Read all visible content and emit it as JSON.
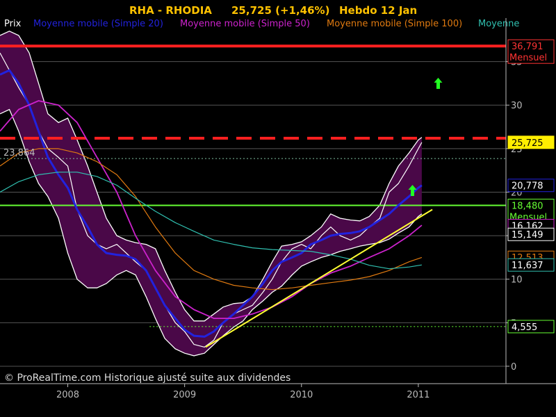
{
  "header": {
    "title": "RHA - RHODIA",
    "price_change": "25,725 (+1,46%)",
    "period": "Hebdo  12 Jan"
  },
  "legend": [
    {
      "label": "Prix",
      "color": "#ffffff"
    },
    {
      "label": "Moyenne mobile (Simple 20)",
      "color": "#2222dd"
    },
    {
      "label": "Moyenne mobile (Simple 50)",
      "color": "#cc22cc"
    },
    {
      "label": "Moyenne mobile (Simple 100)",
      "color": "#e07a10"
    },
    {
      "label": "Moyenne",
      "color": "#30c0b0"
    }
  ],
  "copyright": "© ProRealTime.com Historique ajusté suite aux dividendes",
  "chart_data": {
    "type": "line",
    "ylim": [
      -2,
      40
    ],
    "xlim": [
      2007.42,
      2011.75
    ],
    "y_ticks": [
      "0",
      "5",
      "10",
      "15",
      "20",
      "25",
      "30",
      "35"
    ],
    "y_tick_values": [
      0,
      5,
      10,
      15,
      20,
      25,
      30,
      35
    ],
    "x_ticks": [
      "2008",
      "2009",
      "2010",
      "2011"
    ],
    "x_tick_values": [
      2008,
      2009,
      2010,
      2011
    ],
    "series": [
      {
        "key": "price",
        "color": "#ffffff",
        "x": [
          2007.42,
          2007.5,
          2007.58,
          2007.67,
          2007.75,
          2007.83,
          2007.92,
          2008.0,
          2008.08,
          2008.17,
          2008.25,
          2008.33,
          2008.42,
          2008.5,
          2008.58,
          2008.67,
          2008.75,
          2008.83,
          2008.92,
          2009.0,
          2009.08,
          2009.17,
          2009.25,
          2009.33,
          2009.42,
          2009.5,
          2009.58,
          2009.67,
          2009.75,
          2009.83,
          2009.92,
          2010.0,
          2010.08,
          2010.17,
          2010.25,
          2010.33,
          2010.42,
          2010.5,
          2010.58,
          2010.67,
          2010.75,
          2010.83,
          2010.92,
          2011.0,
          2011.03
        ],
        "y": [
          36,
          34,
          32,
          30,
          27,
          25,
          24,
          23,
          18,
          15,
          14,
          13.5,
          14,
          13,
          12,
          11,
          9,
          7,
          5,
          4,
          2.5,
          2.2,
          3,
          5,
          6,
          6.5,
          7,
          8.5,
          10,
          12,
          13.5,
          14,
          13.5,
          15,
          16,
          15,
          14.5,
          15,
          16,
          17,
          20,
          21,
          23,
          25,
          25.725
        ]
      },
      {
        "key": "ma20",
        "color": "#2222dd",
        "x": [
          2007.42,
          2007.5,
          2007.58,
          2007.67,
          2007.75,
          2007.83,
          2007.92,
          2008.0,
          2008.08,
          2008.17,
          2008.25,
          2008.33,
          2008.42,
          2008.5,
          2008.58,
          2008.67,
          2008.75,
          2008.83,
          2008.92,
          2009.0,
          2009.08,
          2009.17,
          2009.25,
          2009.33,
          2009.42,
          2009.5,
          2009.58,
          2009.67,
          2009.75,
          2009.83,
          2009.92,
          2010.0,
          2010.08,
          2010.17,
          2010.25,
          2010.33,
          2010.42,
          2010.5,
          2010.58,
          2010.67,
          2010.75,
          2010.83,
          2010.92,
          2011.0,
          2011.03
        ],
        "y": [
          33.5,
          34,
          32.5,
          30,
          27,
          24,
          22,
          20.5,
          18,
          16,
          14,
          13,
          12.8,
          12.7,
          12.3,
          11,
          9,
          7,
          5.5,
          4.2,
          3.5,
          3.4,
          4,
          5,
          6,
          7,
          8,
          9.5,
          11,
          12,
          12.5,
          13,
          14,
          14.5,
          15,
          15.2,
          15.3,
          15.5,
          16,
          16.8,
          17.5,
          18.5,
          19.5,
          20.5,
          20.778
        ]
      },
      {
        "key": "ma50",
        "color": "#cc22cc",
        "x": [
          2007.42,
          2007.58,
          2007.75,
          2007.92,
          2008.08,
          2008.25,
          2008.42,
          2008.58,
          2008.75,
          2008.92,
          2009.08,
          2009.25,
          2009.42,
          2009.58,
          2009.75,
          2009.92,
          2010.08,
          2010.25,
          2010.42,
          2010.58,
          2010.75,
          2010.92,
          2011.03
        ],
        "y": [
          27,
          29.5,
          30.5,
          30,
          28,
          24,
          20,
          15,
          11,
          8,
          6.5,
          5.5,
          5.5,
          6,
          6.8,
          8,
          9.5,
          10.7,
          11.5,
          12.5,
          13.5,
          15,
          16.2
        ]
      },
      {
        "key": "ma100",
        "color": "#e07a10",
        "x": [
          2007.42,
          2007.58,
          2007.75,
          2007.92,
          2008.08,
          2008.25,
          2008.42,
          2008.58,
          2008.75,
          2008.92,
          2009.08,
          2009.25,
          2009.42,
          2009.58,
          2009.75,
          2009.92,
          2010.08,
          2010.25,
          2010.42,
          2010.58,
          2010.75,
          2010.92,
          2011.03
        ],
        "y": [
          23,
          24.5,
          25,
          25,
          24.5,
          23.5,
          22,
          19.5,
          16,
          13,
          11,
          10,
          9.3,
          9,
          8.8,
          9,
          9.3,
          9.6,
          9.9,
          10.3,
          11,
          12,
          12.5
        ]
      },
      {
        "key": "ma200",
        "color": "#30c0b0",
        "x": [
          2007.42,
          2007.58,
          2007.75,
          2007.92,
          2008.08,
          2008.25,
          2008.42,
          2008.58,
          2008.75,
          2008.92,
          2009.08,
          2009.25,
          2009.42,
          2009.58,
          2009.75,
          2009.92,
          2010.08,
          2010.25,
          2010.42,
          2010.58,
          2010.75,
          2010.92,
          2011.03
        ],
        "y": [
          20,
          21.2,
          22,
          22.3,
          22.3,
          21.8,
          20.8,
          19.3,
          17.8,
          16.5,
          15.5,
          14.5,
          14,
          13.6,
          13.4,
          13.3,
          13.2,
          12.8,
          12.3,
          11.6,
          11.2,
          11.4,
          11.637
        ]
      }
    ],
    "band": {
      "x": [
        2007.42,
        2007.5,
        2007.58,
        2007.67,
        2007.75,
        2007.83,
        2007.92,
        2008.0,
        2008.08,
        2008.17,
        2008.25,
        2008.33,
        2008.42,
        2008.5,
        2008.58,
        2008.67,
        2008.75,
        2008.83,
        2008.92,
        2009.0,
        2009.08,
        2009.17,
        2009.25,
        2009.33,
        2009.42,
        2009.5,
        2009.58,
        2009.67,
        2009.75,
        2009.83,
        2009.92,
        2010.0,
        2010.08,
        2010.17,
        2010.25,
        2010.33,
        2010.42,
        2010.5,
        2010.58,
        2010.67,
        2010.75,
        2010.83,
        2010.92,
        2011.0,
        2011.03
      ],
      "upper": [
        38,
        38.5,
        38,
        36,
        32.5,
        29,
        28,
        28.5,
        26,
        23,
        20,
        17,
        15,
        14.5,
        14.2,
        14,
        13.5,
        11,
        8.5,
        6.5,
        5.2,
        5.2,
        6,
        6.8,
        7.2,
        7.3,
        8,
        10,
        12,
        13.8,
        14,
        14.3,
        15,
        16,
        17.5,
        17,
        16.8,
        16.7,
        17.2,
        18.5,
        21,
        23,
        24.5,
        26,
        26.3
      ],
      "lower": [
        29,
        29.5,
        27,
        23.5,
        21,
        19.5,
        17,
        13,
        10,
        9,
        9,
        9.5,
        10.5,
        11,
        10.5,
        8,
        5.5,
        3.2,
        2,
        1.5,
        1.2,
        1.5,
        2.5,
        3.5,
        4.5,
        5.2,
        6.5,
        7.5,
        8.5,
        9.2,
        10.5,
        11.5,
        12,
        12.5,
        12.8,
        13.2,
        13.5,
        13.8,
        14,
        14.2,
        14.6,
        15.3,
        16,
        17.2,
        17.5
      ]
    },
    "lines": [
      {
        "name": "resistance-line",
        "y": 36.791,
        "color": "#ff2020",
        "style": "solid"
      },
      {
        "name": "dashed-resistance",
        "y": 26.2,
        "color": "#ff2020",
        "style": "dashed"
      },
      {
        "name": "support-green",
        "y": 18.48,
        "color": "#66ff33",
        "style": "solid"
      },
      {
        "name": "dotted-23864",
        "y": 23.864,
        "color": "#7fbf9f",
        "style": "dotted"
      },
      {
        "name": "dotted-4555",
        "y": 4.555,
        "color": "#66ff33",
        "style": "dotted"
      }
    ],
    "trendline": {
      "x": [
        2009.18,
        2011.12
      ],
      "y": [
        2.2,
        18.0
      ],
      "color": "#ffff33"
    },
    "price_labels": [
      {
        "text": "36,791",
        "sub": "Mensuel",
        "value": 36.791,
        "bg": "#000000",
        "fg": "#ff3333",
        "border": "#ff3333"
      },
      {
        "text": "25,725",
        "sub": "",
        "value": 25.725,
        "bg": "#ffee00",
        "fg": "#000000",
        "border": "#ffee00"
      },
      {
        "text": "20,778",
        "sub": "",
        "value": 20.778,
        "bg": "#000000",
        "fg": "#ffffff",
        "border": "#2222dd"
      },
      {
        "text": "18,480",
        "sub": "Mensuel",
        "value": 18.48,
        "bg": "#000000",
        "fg": "#66ff33",
        "border": "#66ff33"
      },
      {
        "text": "16,162",
        "sub": "",
        "value": 16.162,
        "bg": "#000000",
        "fg": "#ffffff",
        "border": "#cc22cc"
      },
      {
        "text": "15,149",
        "sub": "",
        "value": 15.149,
        "bg": "#000000",
        "fg": "#ffffff",
        "border": "#ffffff"
      },
      {
        "text": "12,513",
        "sub": "",
        "value": 12.513,
        "bg": "#000000",
        "fg": "#e07a10",
        "border": "#e07a10"
      },
      {
        "text": "11,637",
        "sub": "",
        "value": 11.637,
        "bg": "#000000",
        "fg": "#ffffff",
        "border": "#30c0b0"
      },
      {
        "text": "4,555",
        "sub": "",
        "value": 4.555,
        "bg": "#000000",
        "fg": "#ffffff",
        "border": "#66ff33"
      }
    ],
    "left_annotation": {
      "text": "23,864",
      "value": 23.864
    },
    "arrows": [
      {
        "x": 2011.17,
        "y": 32.5,
        "color": "#22ff22"
      },
      {
        "x": 2010.95,
        "y": 20.2,
        "color": "#22ff22"
      }
    ]
  }
}
